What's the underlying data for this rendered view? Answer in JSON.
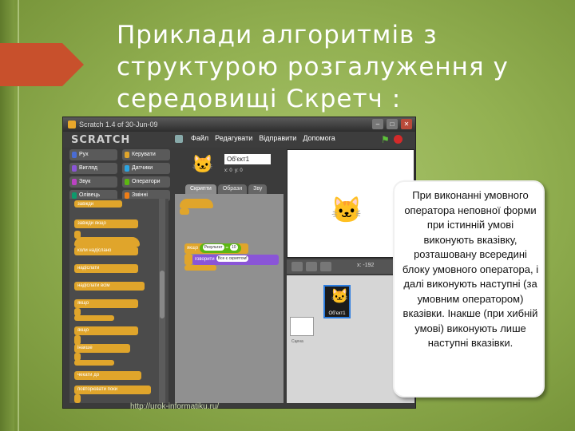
{
  "slide": {
    "title_line1": "Приклади алгоритмів з",
    "title_line2": "структурою розгалуження у",
    "title_line3_a": "середовищі ",
    "title_line3_b": "Скретч",
    "title_line3_c": " :",
    "accent_color": "#c8502c",
    "url": "http://urok-informatiku.ru/"
  },
  "window": {
    "title": "Scratch 1.4 of 30-Jun-09",
    "logo": "SCRATCH",
    "menu": [
      "Файл",
      "Редагувати",
      "Відправити",
      "Допомога"
    ],
    "categories": [
      {
        "label": "Рух",
        "color": "#4a6cd4"
      },
      {
        "label": "Керувати",
        "color": "#e0a52b"
      },
      {
        "label": "Вигляд",
        "color": "#8a55d7"
      },
      {
        "label": "Датчики",
        "color": "#2ca5e2"
      },
      {
        "label": "Звук",
        "color": "#bb42c3"
      },
      {
        "label": "Оператори",
        "color": "#5cb712"
      },
      {
        "label": "Олівець",
        "color": "#0e9a6c"
      },
      {
        "label": "Змінні",
        "color": "#ee7d16"
      }
    ],
    "palette_blocks": [
      "завжди",
      "завжди якщо",
      "коли надіслано",
      "надіслати",
      "надіслати всім",
      "якщо",
      "якщо",
      "інакше",
      "чекати до",
      "повторювати поки"
    ],
    "sprite_name": "Об'єкт1",
    "sprite_x": "x: 0",
    "sprite_y": "y: 0",
    "tabs": [
      "Скрипти",
      "Образи",
      "Зву"
    ],
    "script_if": "якщо",
    "script_cond_a": "Результат",
    "script_cond_op": "=",
    "script_cond_b": "10",
    "script_say": "говорити",
    "script_say_text": "Все є скриптом!",
    "stage_xy": "x: -192",
    "stage_label": "Сцена",
    "sprite_tile_name": "Об'єкт1"
  },
  "callout": {
    "text": "При виконанні умовного оператора неповної форми при істинній умові виконують вказівку, розташовану всередині блоку умовного оператора, і далі виконують наступні (за умовним оператором) вказівки. Інакше (при хибній умові) виконують лише наступні вказівки."
  }
}
